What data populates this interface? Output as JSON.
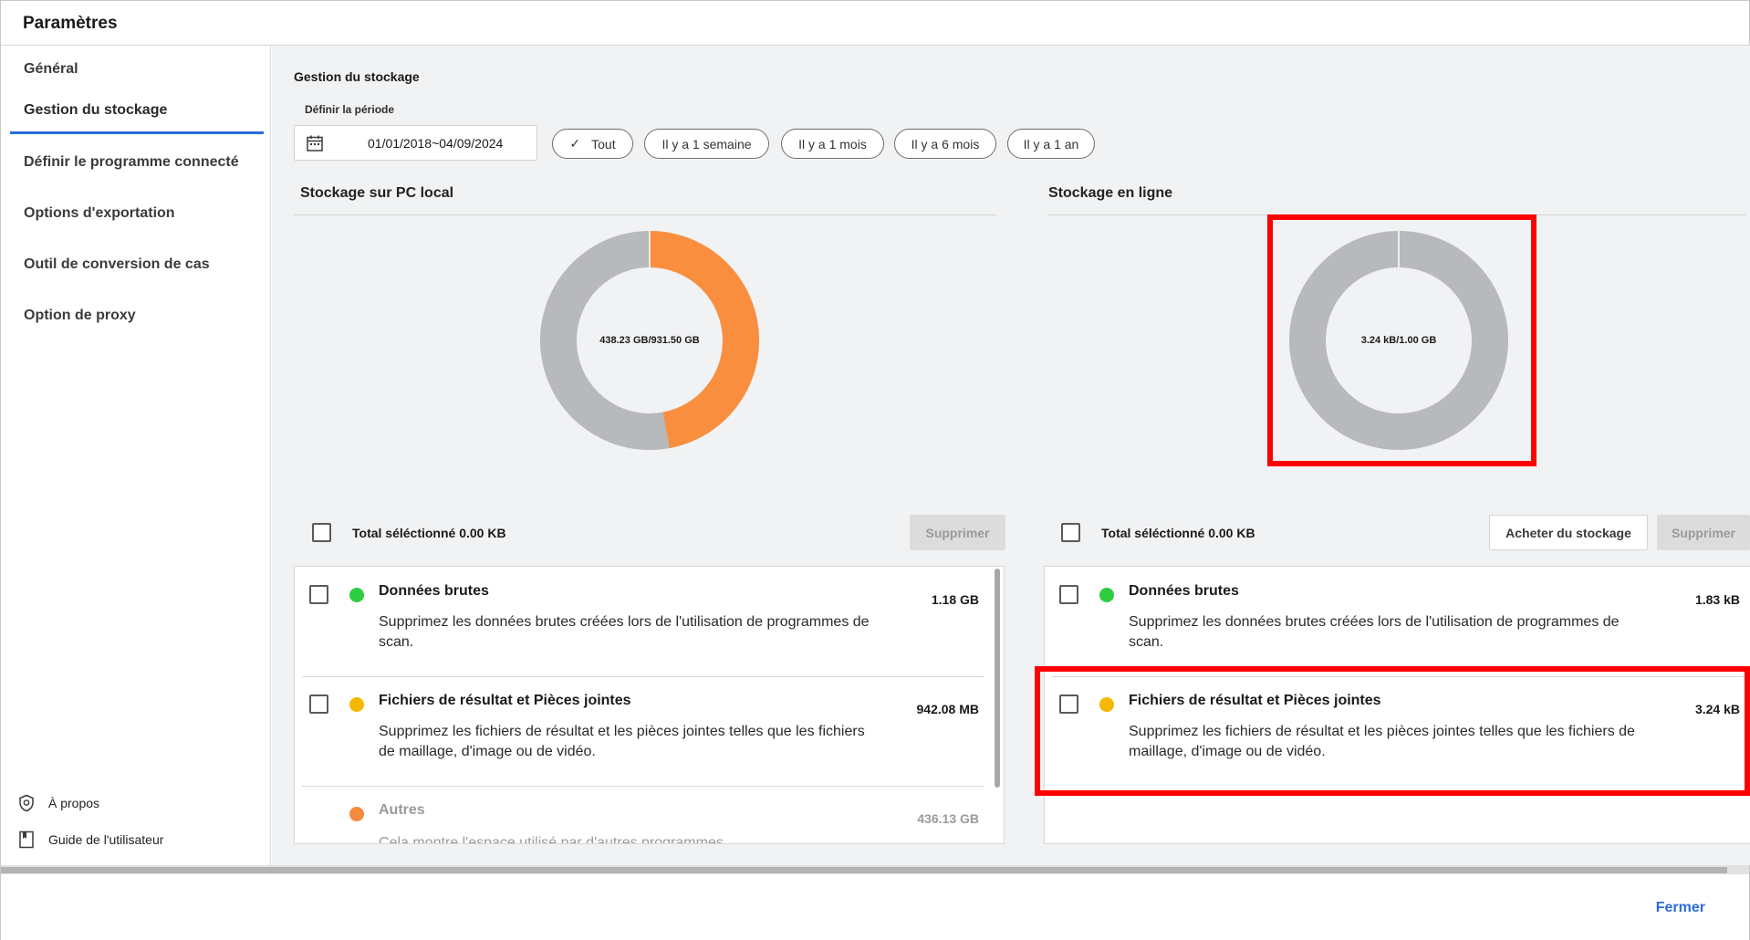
{
  "window": {
    "title": "Paramètres"
  },
  "sidebar": {
    "items": [
      {
        "label": "Général"
      },
      {
        "label": "Gestion du stockage",
        "active": true
      },
      {
        "label": "Définir le programme connecté"
      },
      {
        "label": "Options d'exportation"
      },
      {
        "label": "Outil de conversion de cas"
      },
      {
        "label": "Option de proxy"
      }
    ],
    "footer": [
      {
        "label": "À propos",
        "icon": "shield-icon"
      },
      {
        "label": "Guide de l'utilisateur",
        "icon": "book-icon"
      }
    ]
  },
  "main": {
    "title": "Gestion du stockage",
    "period": {
      "label": "Définir la période",
      "date_range": "01/01/2018~04/09/2024",
      "chips": [
        {
          "label": "Tout",
          "selected": true
        },
        {
          "label": "Il y a 1 semaine"
        },
        {
          "label": "Il y a 1 mois"
        },
        {
          "label": "Il y a 6 mois"
        },
        {
          "label": "Il y a 1 an"
        }
      ]
    },
    "local": {
      "heading": "Stockage sur PC local",
      "donut_label": "438.23 GB/931.50 GB",
      "used_fraction": 0.4705,
      "total_label": "Total séléctionné 0.00 KB",
      "delete_label": "Supprimer",
      "items": [
        {
          "title": "Données brutes",
          "desc_line1": "Supprimez les données brutes créées lors de l'utilisation de programmes de",
          "desc_line2": "scan.",
          "size": "1.18 GB",
          "color": "#2ecc40"
        },
        {
          "title": "Fichiers de résultat et Pièces jointes",
          "desc_line1": "Supprimez les fichiers de résultat et les pièces jointes telles que les fichiers",
          "desc_line2": "de maillage, d'image ou de vidéo.",
          "size": "942.08 MB",
          "color": "#f5b800"
        },
        {
          "title": "Autres",
          "desc_line1": "Cela montre l'espace utilisé par d'autres programmes.",
          "desc_line2": "",
          "size": "436.13 GB",
          "color": "#f7893b"
        }
      ]
    },
    "online": {
      "heading": "Stockage en ligne",
      "donut_label": "3.24 kB/1.00 GB",
      "used_fraction": 3e-06,
      "total_label": "Total séléctionné 0.00 KB",
      "buy_label": "Acheter du stockage",
      "delete_label": "Supprimer",
      "items": [
        {
          "title": "Données brutes",
          "desc_line1": "Supprimez les données brutes créées lors de l'utilisation de programmes de",
          "desc_line2": "scan.",
          "size": "1.83 kB",
          "color": "#2ecc40"
        },
        {
          "title": "Fichiers de résultat et Pièces jointes",
          "desc_line1": "Supprimez les fichiers de résultat et les pièces jointes telles que les fichiers de",
          "desc_line2": "maillage, d'image ou de vidéo.",
          "size": "3.24 kB",
          "color": "#f5b800"
        }
      ]
    }
  },
  "footer": {
    "close_label": "Fermer"
  },
  "colors": {
    "accent": "#2b6cde",
    "used": "#f98f3e",
    "free": "#b8b9bb",
    "highlight": "#ff0000"
  }
}
